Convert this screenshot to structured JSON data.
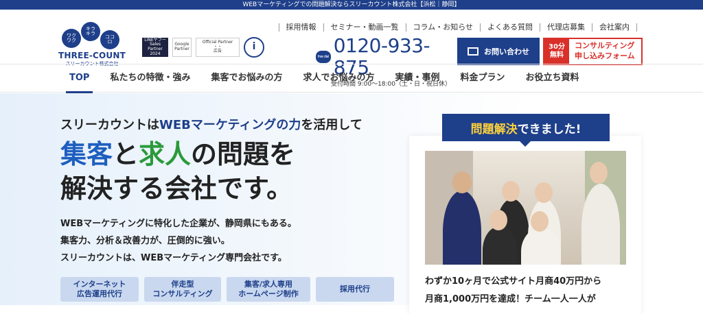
{
  "topbar": {
    "text": "WEBマーケティングでの問題解決ならスリーカウント株式会社【浜松｜静岡】"
  },
  "logo": {
    "bubbles": [
      "ワク\nワク",
      "キラ\nキラ",
      "ココ\nロ"
    ],
    "brand": "THREE-COUNT",
    "sub": "スリーカウント株式会社"
  },
  "badges": {
    "line": "LINEヤフー\nSales Partner\n2024",
    "google": "Google\nPartner",
    "partner": "Official Partner\n・・\n広告",
    "info": "i"
  },
  "topnav": [
    "採用情報",
    "セミナー・動画一覧",
    "コラム・お知らせ",
    "よくある質問",
    "代理店募集",
    "会社案内"
  ],
  "phone": {
    "icon": "free dial",
    "number": "0120-933-875",
    "hours": "受付時間 9:00～18:00（土・日・祝日休）"
  },
  "contact": {
    "label": "お問い合わせ"
  },
  "consult": {
    "free_top": "30分",
    "free_bottom": "無料",
    "line1": "コンサルティング",
    "line2": "申し込みフォーム"
  },
  "mainnav": [
    "TOP",
    "私たちの特徴・強み",
    "集客でお悩みの方",
    "求人でお悩みの方",
    "実績・事例",
    "料金プラン",
    "お役立ち資料"
  ],
  "hero": {
    "lead_a": "スリーカウントは",
    "lead_hl": "WEBマーケティングの力",
    "lead_b": "を活用して",
    "title_blue": "集客",
    "title_mid": "と",
    "title_green": "求人",
    "title_rest": "の問題を",
    "title_line2": "解決する会社です。",
    "desc": [
      "WEBマーケティングに特化した企業が、静岡県にもある。",
      "集客力、分析＆改善力が、圧倒的に強い。",
      "スリーカウントは、WEBマーケティング専門会社です。"
    ],
    "tags": [
      {
        "l1": "インターネット",
        "l2": "広告運用代行"
      },
      {
        "l1": "伴走型",
        "l2": "コンサルティング"
      },
      {
        "l1": "集客/求人専用",
        "l2": "ホームページ制作"
      },
      {
        "l1": "採用代行",
        "l2": ""
      }
    ]
  },
  "card": {
    "title_hl": "問題解決",
    "title_rest": "できました!",
    "text": [
      "わずか10ヶ月で公式サイト月商40万円から",
      "月商1,000万円を達成！チーム一人一人が"
    ]
  }
}
